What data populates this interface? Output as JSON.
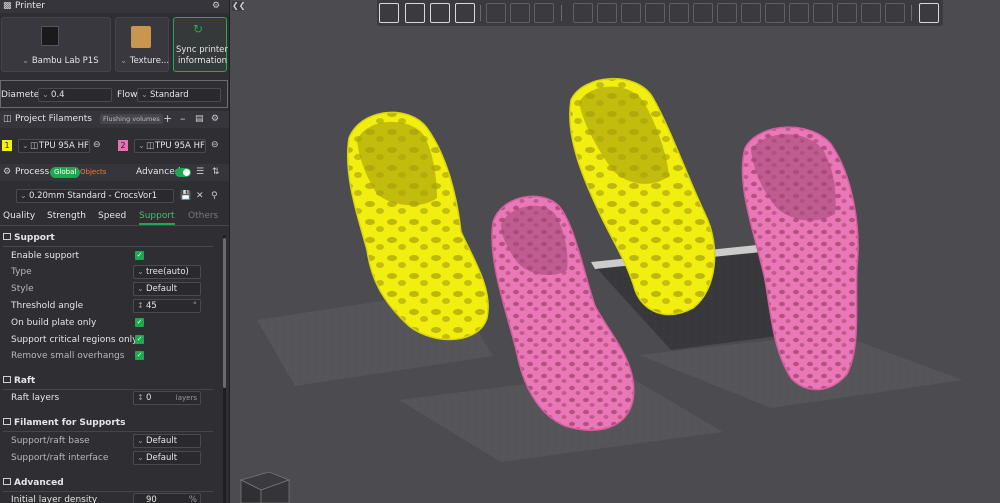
{
  "colors": {
    "accent": "#1ea950",
    "filament1": "#f5f10a",
    "filament2": "#ea6fb4",
    "global_badge": "#1ea950",
    "objects_text": "#f07a3c"
  },
  "printer": {
    "header": "Printer",
    "printer_name": "Bambu Lab P1S",
    "plate_name": "Texture...",
    "sync_label_line1": "Sync printer",
    "sync_label_line2": "information",
    "diameter_label": "Diameter",
    "diameter_value": "0.4",
    "flow_label": "Flow",
    "flow_value": "Standard"
  },
  "filaments": {
    "header": "Project Filaments",
    "flushing_button": "Flushing volumes",
    "items": [
      {
        "index": "1",
        "name": "TPU 95A HF"
      },
      {
        "index": "2",
        "name": "TPU 95A HF ..."
      }
    ]
  },
  "process": {
    "header": "Process",
    "global_label": "Global",
    "objects_label": "Objects",
    "advanced_label": "Advanced",
    "preset": "0.20mm Standard - CrocsVor1"
  },
  "tabs": [
    "Quality",
    "Strength",
    "Speed",
    "Support",
    "Others"
  ],
  "support": {
    "section": "Support",
    "enable_label": "Enable support",
    "type_label": "Type",
    "type_value": "tree(auto)",
    "style_label": "Style",
    "style_value": "Default",
    "threshold_label": "Threshold angle",
    "threshold_value": "45",
    "threshold_unit": "°",
    "build_plate_label": "On build plate only",
    "critical_label": "Support critical regions only",
    "remove_label": "Remove small overhangs"
  },
  "raft": {
    "section": "Raft",
    "layers_label": "Raft layers",
    "layers_value": "0",
    "layers_unit": "layers"
  },
  "filament_supports": {
    "section": "Filament for Supports",
    "base_label": "Support/raft base",
    "base_value": "Default",
    "interface_label": "Support/raft interface",
    "interface_value": "Default"
  },
  "advanced": {
    "section": "Advanced",
    "density_label": "Initial layer density",
    "density_value": "90",
    "density_unit": "%"
  },
  "viewport": {
    "toolbar_icons": [
      "add-cube-icon",
      "arrange-grid-icon",
      "orient-icon",
      "plate-icon",
      "split-objects-icon",
      "split-parts-icon",
      "layers-icon",
      "move-icon",
      "rotate-icon",
      "scale-icon",
      "cut-icon",
      "flatten-icon",
      "support-paint-icon",
      "seam-paint-icon",
      "text-icon",
      "measure-icon",
      "assembly-icon",
      "brush-icon",
      "view-icon"
    ]
  }
}
